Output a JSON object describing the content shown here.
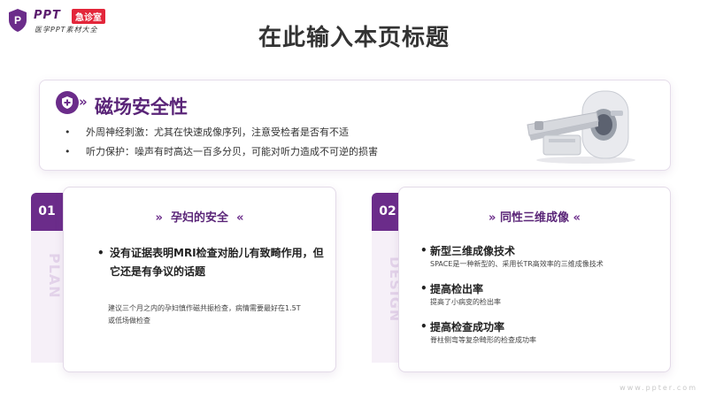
{
  "logo": {
    "top_text": "PPT",
    "badge_text": "急诊室",
    "sub_text": "医学PPT素材大全"
  },
  "page_title": "在此输入本页标题",
  "top_card": {
    "heading": "磁场安全性",
    "chevrons": "»",
    "bullets": [
      "外周神经刺激：尤其在快速成像序列，注意受检者是否有不适",
      "听力保护：噪声有时高达一百多分贝，可能对听力造成不可逆的损害"
    ]
  },
  "card1": {
    "number": "01",
    "vertical": "PLAN",
    "title": "孕妇的安全",
    "chev_left": "»",
    "chev_right": "«",
    "bullet": "没有证据表明MRI检查对胎儿有致畸作用，但它还是有争议的话题",
    "note": "建议三个月之内的孕妇慎作磁共振检查，病情需要最好在1.5T或低场做检查"
  },
  "card2": {
    "number": "02",
    "vertical": "DESIGN",
    "title": "同性三维成像",
    "chev_left": "»",
    "chev_right": "«",
    "items": [
      {
        "heading": "新型三维成像技术",
        "desc": "SPACE是一种新型的、采用长TR高效率的三维成像技术"
      },
      {
        "heading": "提高检出率",
        "desc": "提高了小病变的检出率"
      },
      {
        "heading": "提高检查成功率",
        "desc": "脊柱侧弯等复杂畸形的检查成功率"
      }
    ]
  },
  "footer_url": "www.ppter.com",
  "colors": {
    "accent": "#6b2c8a",
    "heading": "#5a2578",
    "badge": "#e3263a"
  }
}
